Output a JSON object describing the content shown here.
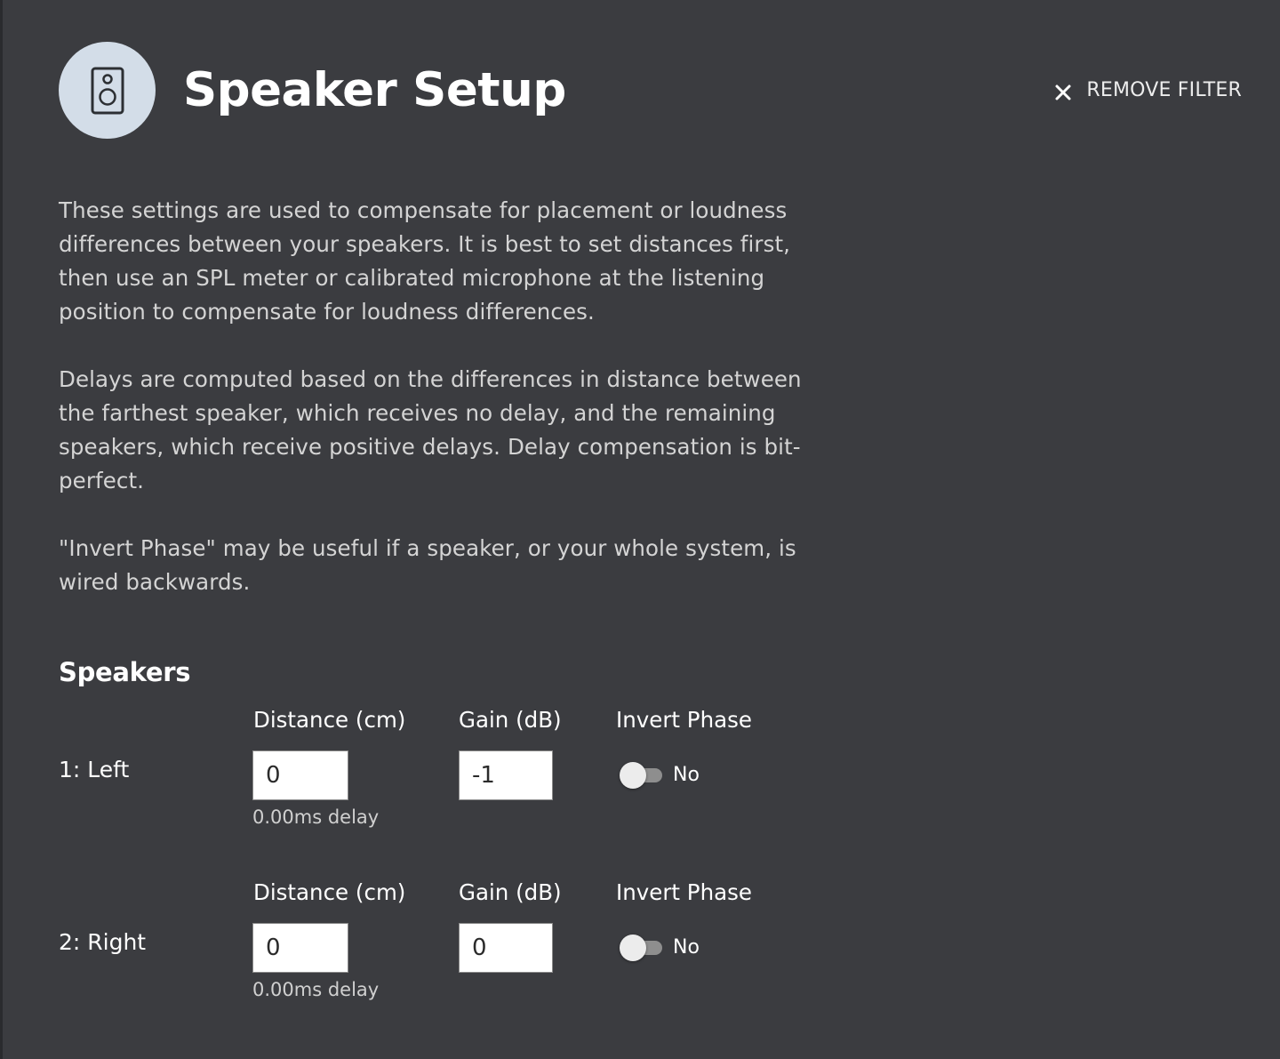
{
  "header": {
    "title": "Speaker Setup",
    "icon": "speaker-icon",
    "remove_filter_label": "REMOVE FILTER",
    "remove_filter_icon": "close-icon"
  },
  "description": {
    "paragraphs": [
      "These settings are used to compensate for placement or loudness differences between your speakers. It is best to set distances first, then use an SPL meter or calibrated microphone at the listening position to compensate for loudness differences.",
      "Delays are computed based on the differences in distance between the farthest speaker, which receives no delay, and the remaining speakers, which receive positive delays. Delay compensation is bit-perfect.",
      "\"Invert Phase\" may be useful if a speaker, or your whole system, is wired backwards."
    ]
  },
  "speakers_section": {
    "title": "Speakers",
    "speakers": [
      {
        "name": "1: Left",
        "distance_label": "Distance (cm)",
        "distance_value": "0",
        "delay_text": "0.00ms delay",
        "gain_label": "Gain (dB)",
        "gain_value": "-1",
        "invert_label": "Invert Phase",
        "invert_value": "No",
        "invert_on": false
      },
      {
        "name": "2: Right",
        "distance_label": "Distance (cm)",
        "distance_value": "0",
        "delay_text": "0.00ms delay",
        "gain_label": "Gain (dB)",
        "gain_value": "0",
        "invert_label": "Invert Phase",
        "invert_value": "No",
        "invert_on": false
      }
    ]
  },
  "colors": {
    "background": "#3b3c40",
    "icon_circle": "#d3dde8",
    "text_primary": "#ffffff",
    "text_secondary": "#d4d4d4"
  }
}
